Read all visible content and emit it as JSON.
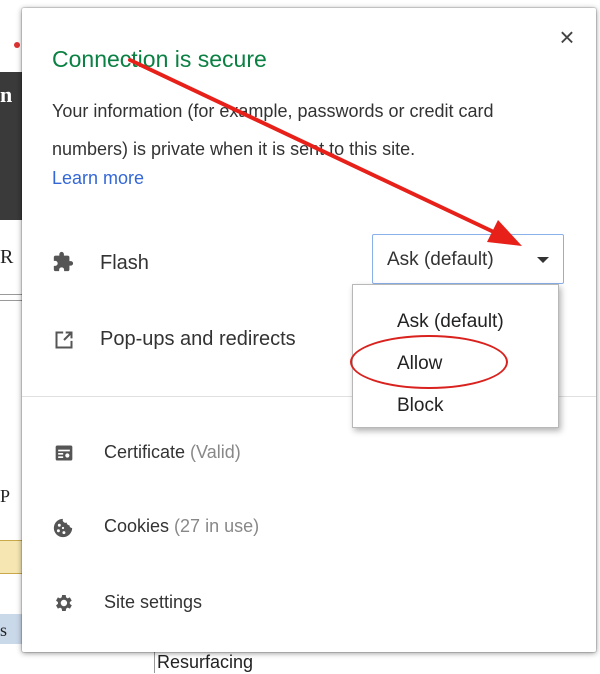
{
  "popup": {
    "close_label": "×",
    "title": "Connection is secure",
    "description": "Your information (for example, passwords or credit card numbers) is private when it is sent to this site.",
    "learn_more": "Learn more",
    "flash": {
      "label": "Flash",
      "icon": "puzzle-icon",
      "select_value": "Ask (default)",
      "options": [
        "Ask (default)",
        "Allow",
        "Block"
      ]
    },
    "popups": {
      "label": "Pop-ups and redirects",
      "icon": "popup-icon"
    },
    "certificate": {
      "label": "Certificate",
      "status": "(Valid)",
      "icon": "certificate-icon"
    },
    "cookies": {
      "label": "Cookies",
      "status": "(27 in use)",
      "icon": "cookie-icon"
    },
    "site_settings": {
      "label": "Site settings",
      "icon": "gear-icon"
    }
  },
  "background": {
    "bottom_text": "Resurfacing"
  },
  "annotations": {
    "arrow_color": "#e8201a",
    "ellipse_color": "#d9221e"
  }
}
